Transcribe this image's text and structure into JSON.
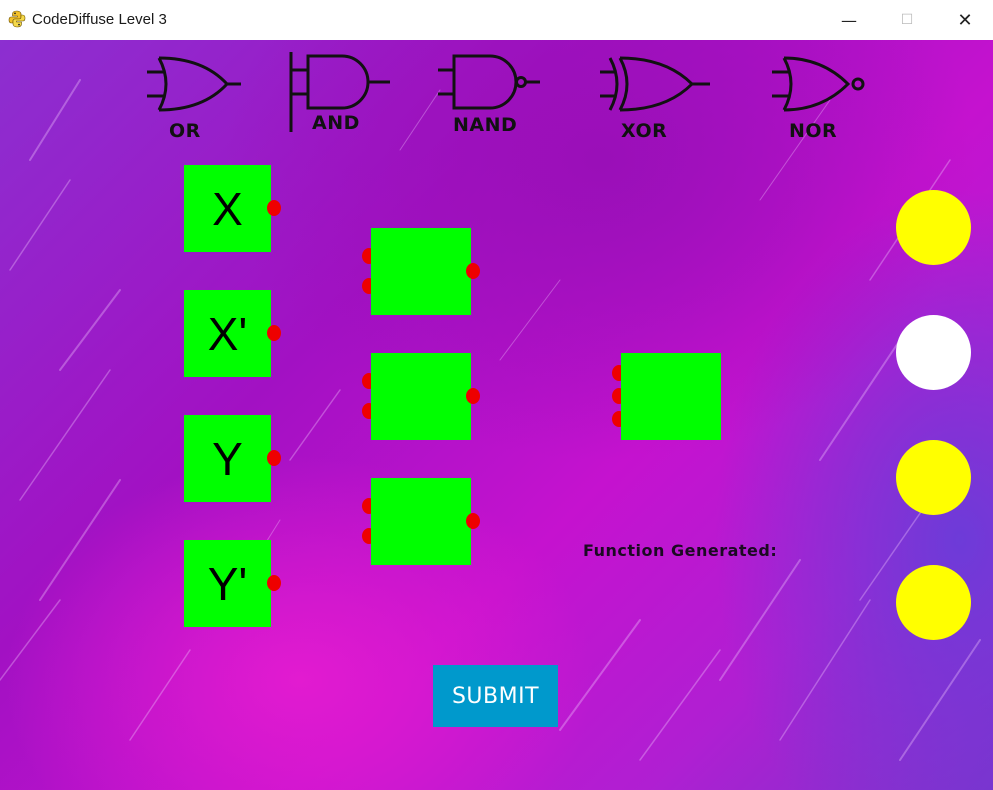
{
  "window": {
    "title": "CodeDiffuse Level 3",
    "minimize_glyph": "—",
    "maximize_glyph": "☐",
    "close_glyph": "✕"
  },
  "gate_legend": [
    {
      "label": "OR",
      "icon": "or-gate-icon"
    },
    {
      "label": "AND",
      "icon": "and-gate-icon"
    },
    {
      "label": "NAND",
      "icon": "nand-gate-icon"
    },
    {
      "label": "XOR",
      "icon": "xor-gate-icon"
    },
    {
      "label": "NOR",
      "icon": "nor-gate-icon"
    }
  ],
  "variables": [
    {
      "label": "X"
    },
    {
      "label": "X'"
    },
    {
      "label": "Y"
    },
    {
      "label": "Y'"
    }
  ],
  "gate_slots": {
    "first_layer_count": 3,
    "second_layer_count": 1
  },
  "output_lamps": [
    {
      "color": "#ffff00",
      "state": "on"
    },
    {
      "color": "#ffffff",
      "state": "off"
    },
    {
      "color": "#ffff00",
      "state": "on"
    },
    {
      "color": "#ffff00",
      "state": "on"
    }
  ],
  "function_label": "Function Generated:",
  "submit_label": "SUBMIT",
  "colors": {
    "slot_green": "#00ff00",
    "port_red": "#ee0000",
    "submit_blue": "#0099cc",
    "lamp_on": "#ffff00",
    "lamp_off": "#ffffff"
  }
}
